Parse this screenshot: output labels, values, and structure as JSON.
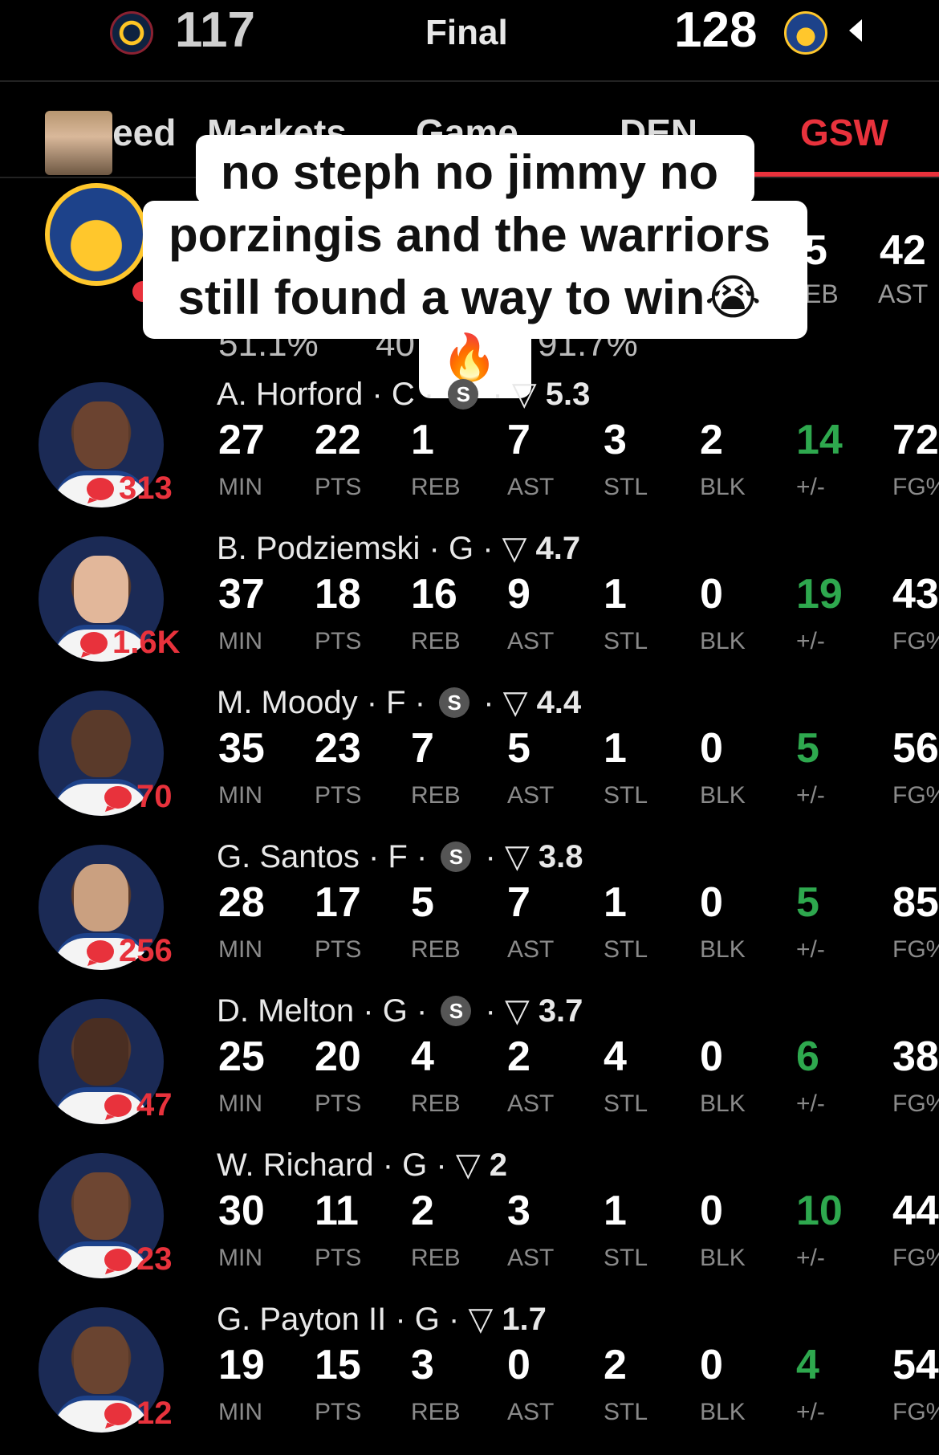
{
  "header": {
    "away_score": "117",
    "status": "Final",
    "home_score": "128",
    "away_team_icon": "nuggets-logo-icon",
    "home_team_icon": "warriors-logo-icon"
  },
  "tabs": [
    {
      "label": "Feed"
    },
    {
      "label": "Markets"
    },
    {
      "label": "Game"
    },
    {
      "label": "DEN"
    },
    {
      "label": "GSW",
      "active": true
    }
  ],
  "team_summary": {
    "reb_value": "5",
    "ast_value": "42",
    "reb_label": "EB",
    "ast_label": "AST",
    "pct_1": "51.1%",
    "pct_2": "40",
    "pct_3": "91.7%"
  },
  "caption": {
    "line1": "no steph no jimmy no",
    "line2": "porzingis and the warriors",
    "line3": "still found a way to win😭",
    "line4": "🔥"
  },
  "stat_labels": {
    "min": "MIN",
    "pts": "PTS",
    "reb": "REB",
    "ast": "AST",
    "stl": "STL",
    "blk": "BLK",
    "pm": "+/-",
    "fg": "FG%"
  },
  "colors": {
    "accent": "#E8323C",
    "positive": "#2ea84e",
    "background": "#000000"
  },
  "players": [
    {
      "name": "A. Horford",
      "pos": "C",
      "starter": true,
      "rating": "5.3",
      "comments": "313",
      "min": "27",
      "pts": "22",
      "reb": "1",
      "ast": "7",
      "stl": "3",
      "blk": "2",
      "pm": "14",
      "fg": "72"
    },
    {
      "name": "B. Podziemski",
      "pos": "G",
      "starter": false,
      "rating": "4.7",
      "comments": "1.6K",
      "min": "37",
      "pts": "18",
      "reb": "16",
      "ast": "9",
      "stl": "1",
      "blk": "0",
      "pm": "19",
      "fg": "43"
    },
    {
      "name": "M. Moody",
      "pos": "F",
      "starter": true,
      "rating": "4.4",
      "comments": "70",
      "min": "35",
      "pts": "23",
      "reb": "7",
      "ast": "5",
      "stl": "1",
      "blk": "0",
      "pm": "5",
      "fg": "56"
    },
    {
      "name": "G. Santos",
      "pos": "F",
      "starter": true,
      "rating": "3.8",
      "comments": "256",
      "min": "28",
      "pts": "17",
      "reb": "5",
      "ast": "7",
      "stl": "1",
      "blk": "0",
      "pm": "5",
      "fg": "85"
    },
    {
      "name": "D. Melton",
      "pos": "G",
      "starter": true,
      "rating": "3.7",
      "comments": "47",
      "min": "25",
      "pts": "20",
      "reb": "4",
      "ast": "2",
      "stl": "4",
      "blk": "0",
      "pm": "6",
      "fg": "38"
    },
    {
      "name": "W. Richard",
      "pos": "G",
      "starter": false,
      "rating": "2",
      "comments": "23",
      "min": "30",
      "pts": "11",
      "reb": "2",
      "ast": "3",
      "stl": "1",
      "blk": "0",
      "pm": "10",
      "fg": "44"
    },
    {
      "name": "G. Payton II",
      "pos": "G",
      "starter": false,
      "rating": "1.7",
      "comments": "12",
      "min": "19",
      "pts": "15",
      "reb": "3",
      "ast": "0",
      "stl": "2",
      "blk": "0",
      "pm": "4",
      "fg": "54"
    }
  ]
}
